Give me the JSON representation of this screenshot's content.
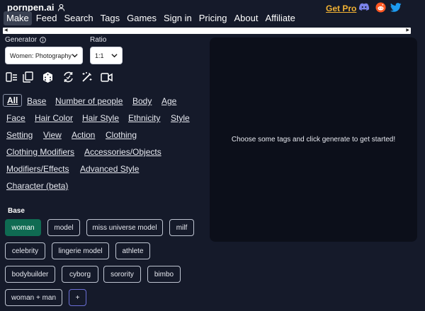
{
  "brand": {
    "name": "pornpen.ai"
  },
  "nav": {
    "items": [
      "Make",
      "Feed",
      "Search",
      "Tags",
      "Games",
      "Sign in",
      "Pricing",
      "About",
      "Affiliate"
    ],
    "active": "Make",
    "get_pro": "Get Pro",
    "social_icons": [
      "discord-icon",
      "reddit-icon",
      "twitter-icon"
    ]
  },
  "colors": {
    "background": "#151a2a",
    "accent_gold": "#f2b233",
    "selected_chip": "#0f6b52",
    "output_panel": "#0c0f1a"
  },
  "generator": {
    "label": "Generator",
    "value": "Women: Photography"
  },
  "ratio": {
    "label": "Ratio",
    "value": "1:1"
  },
  "toolbar_icons": [
    "clear-icon",
    "copy-icon",
    "dice-icon",
    "refresh-icon",
    "magic-wand-icon",
    "video-icon"
  ],
  "categories": [
    "All",
    "Base",
    "Number of people",
    "Body",
    "Age",
    "Face",
    "Hair Color",
    "Hair Style",
    "Ethnicity",
    "Style",
    "Setting",
    "View",
    "Action",
    "Clothing",
    "Clothing Modifiers",
    "Accessories/Objects",
    "Modifiers/Effects",
    "Advanced Style",
    "Character (beta)"
  ],
  "active_category": "All",
  "base_section": {
    "title": "Base",
    "tags": [
      "woman",
      "model",
      "miss universe model",
      "milf",
      "celebrity",
      "lingerie model",
      "athlete",
      "bodybuilder",
      "cyborg",
      "sorority",
      "bimbo",
      "woman + man",
      "+"
    ],
    "selected": "woman"
  },
  "output": {
    "message": "Choose some tags and click generate to get started!"
  }
}
